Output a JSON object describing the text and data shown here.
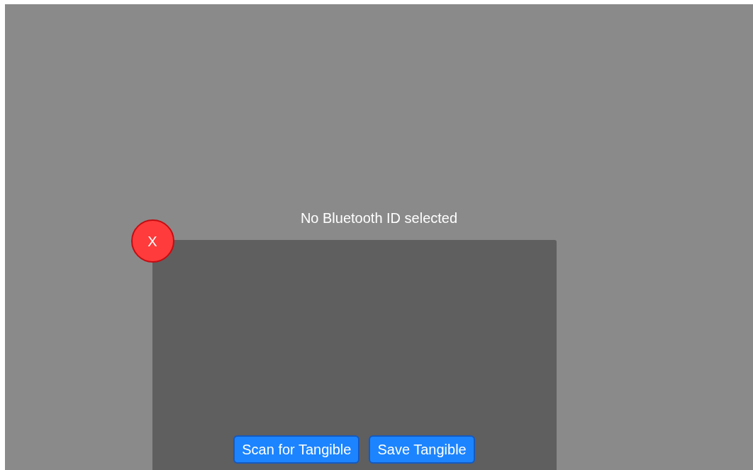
{
  "status_text": "No Bluetooth ID selected",
  "close_button": {
    "label": "X"
  },
  "buttons": [
    {
      "label": "Scan for Tangible"
    },
    {
      "label": "Save Tangible"
    }
  ]
}
